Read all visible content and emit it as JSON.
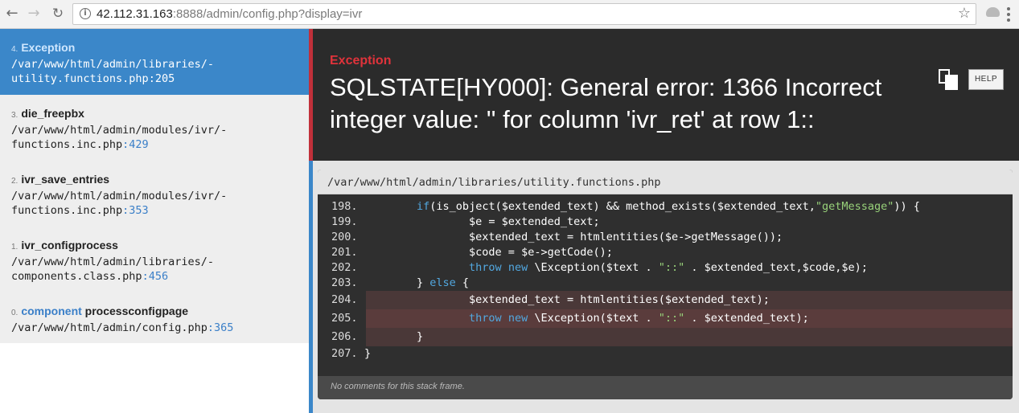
{
  "browser": {
    "url_host": "42.112.31.163",
    "url_rest": ":8888/admin/config.php?display=ivr",
    "icons": [
      "back-arrow-icon",
      "forward-arrow-icon",
      "reload-icon",
      "info-icon",
      "star-icon",
      "extension-icon",
      "menu-icon"
    ]
  },
  "frames": [
    {
      "index": "4.",
      "class": "",
      "function": "Exception",
      "path": "/var/www/html/admin/libraries/-\nutility.functions.php",
      "line": ":205",
      "active": true
    },
    {
      "index": "3.",
      "class": "",
      "function": "die_freepbx",
      "path": "/var/www/html/admin/modules/ivr/-\nfunctions.inc.php",
      "line": ":429",
      "active": false
    },
    {
      "index": "2.",
      "class": "",
      "function": "ivr_save_entries",
      "path": "/var/www/html/admin/modules/ivr/-\nfunctions.inc.php",
      "line": ":353",
      "active": false
    },
    {
      "index": "1.",
      "class": "",
      "function": "ivr_configprocess",
      "path": "/var/www/html/admin/libraries/-\ncomponents.class.php",
      "line": ":456",
      "active": false
    },
    {
      "index": "0.",
      "class": "component",
      "function": " processconfigpage",
      "path": "/var/www/html/admin/config.php",
      "line": ":365",
      "active": false
    }
  ],
  "exception": {
    "type": "Exception",
    "message": "SQLSTATE[HY000]: General error: 1366 Incorrect integer value: '' for column 'ivr_ret' at row 1::",
    "help_label": "HELP"
  },
  "code_view": {
    "file_path": "/var/www/html/admin/libraries/utility.functions.php",
    "lines": [
      {
        "n": "198.",
        "hl": false
      },
      {
        "n": "199.",
        "hl": false
      },
      {
        "n": "200.",
        "hl": false
      },
      {
        "n": "201.",
        "hl": false
      },
      {
        "n": "202.",
        "hl": false
      },
      {
        "n": "203.",
        "hl": false
      },
      {
        "n": "204.",
        "hl": true
      },
      {
        "n": "205.",
        "hl": true
      },
      {
        "n": "206.",
        "hl": true
      },
      {
        "n": "207.",
        "hl": false
      }
    ],
    "comment": "No comments for this stack frame."
  },
  "colors": {
    "accent_blue": "#3b87c9",
    "error_red": "#e0333b",
    "keyword_blue": "#52a8e0",
    "string_green": "#98d27a"
  }
}
